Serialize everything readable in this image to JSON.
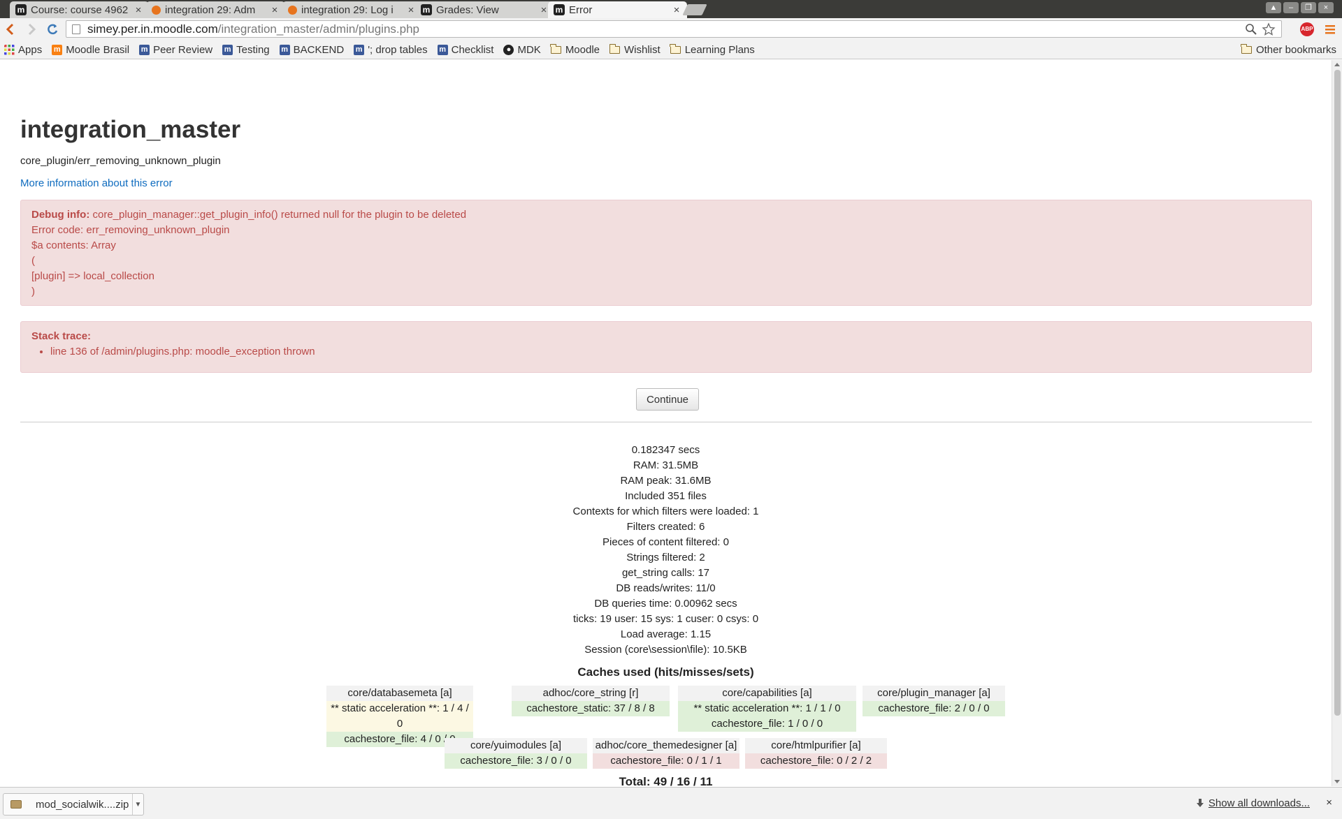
{
  "tabs": [
    {
      "title": "Course: course 4962",
      "favicon": "moodle-icon",
      "active": false
    },
    {
      "title": "integration 29: Adm",
      "favicon": "graduation-hat-icon",
      "active": false
    },
    {
      "title": "integration 29: Log i",
      "favicon": "graduation-hat-icon",
      "active": false
    },
    {
      "title": "Grades: View",
      "favicon": "moodle-icon",
      "active": false
    },
    {
      "title": "Error",
      "favicon": "moodle-icon",
      "active": true
    }
  ],
  "address": {
    "host": "simey.per.in.moodle.com",
    "path": "/integration_master/admin/plugins.php"
  },
  "bookmarks": [
    {
      "label": "Apps",
      "icon": "apps-grid-icon"
    },
    {
      "label": "Moodle Brasil",
      "icon": "moodle-icon"
    },
    {
      "label": "Peer Review",
      "icon": "moodle-icon"
    },
    {
      "label": "Testing",
      "icon": "moodle-icon"
    },
    {
      "label": "BACKEND",
      "icon": "moodle-icon"
    },
    {
      "label": "'; drop tables",
      "icon": "moodle-icon"
    },
    {
      "label": "Checklist",
      "icon": "moodle-icon"
    },
    {
      "label": "MDK",
      "icon": "github-icon"
    },
    {
      "label": "Moodle",
      "icon": "folder-icon"
    },
    {
      "label": "Wishlist",
      "icon": "folder-icon"
    },
    {
      "label": "Learning Plans",
      "icon": "folder-icon"
    }
  ],
  "other_bookmarks": "Other bookmarks",
  "page": {
    "title": "integration_master",
    "error_code_line": "core_plugin/err_removing_unknown_plugin",
    "more_info_link": "More information about this error",
    "debug": {
      "label": "Debug info:",
      "message": "core_plugin_manager::get_plugin_info() returned null for the plugin to be deleted",
      "lines": [
        "Error code: err_removing_unknown_plugin",
        "$a contents: Array",
        "(",
        "[plugin] => local_collection",
        ")"
      ]
    },
    "stack": {
      "label": "Stack trace:",
      "items": [
        "line 136 of /admin/plugins.php: moodle_exception thrown"
      ]
    },
    "continue_label": "Continue",
    "perf": [
      "0.182347 secs",
      "RAM: 31.5MB",
      "RAM peak: 31.6MB",
      "Included 351 files",
      "Contexts for which filters were loaded: 1",
      "Filters created: 6",
      "Pieces of content filtered: 0",
      "Strings filtered: 2",
      "get_string calls: 17",
      "DB reads/writes: 11/0",
      "DB queries time: 0.00962 secs",
      "ticks: 19 user: 15 sys: 1 cuser: 0 csys: 0",
      "Load average: 1.15",
      "Session (core\\session\\file): 10.5KB"
    ],
    "caches_title": "Caches used (hits/misses/sets)",
    "caches": [
      {
        "name": "core/databasemeta [a]",
        "rows": [
          {
            "text": "** static acceleration **: 1 / 4 / 0",
            "status": "yellow"
          },
          {
            "text": "cachestore_file: 4 / 0 / 0",
            "status": "green"
          }
        ]
      },
      {
        "name": "adhoc/core_string [r]",
        "rows": [
          {
            "text": "cachestore_static: 37 / 8 / 8",
            "status": "green"
          }
        ]
      },
      {
        "name": "core/capabilities [a]",
        "rows": [
          {
            "text": "** static acceleration **: 1 / 1 / 0",
            "status": "green"
          },
          {
            "text": "cachestore_file: 1 / 0 / 0",
            "status": "green"
          }
        ]
      },
      {
        "name": "core/plugin_manager [a]",
        "rows": [
          {
            "text": "cachestore_file: 2 / 0 / 0",
            "status": "green"
          }
        ]
      },
      {
        "name": "core/yuimodules [a]",
        "rows": [
          {
            "text": "cachestore_file: 3 / 0 / 0",
            "status": "green"
          }
        ]
      },
      {
        "name": "adhoc/core_themedesigner [a]",
        "rows": [
          {
            "text": "cachestore_file: 0 / 1 / 1",
            "status": "red"
          }
        ]
      },
      {
        "name": "core/htmlpurifier [a]",
        "rows": [
          {
            "text": "cachestore_file: 0 / 2 / 2",
            "status": "red"
          }
        ]
      }
    ],
    "total": "Total: 49 / 16 / 11"
  },
  "downloads": {
    "file": "mod_socialwik....zip",
    "show_all": "Show all downloads...",
    "close": "×"
  },
  "colors": {
    "alert_bg": "#f2dede",
    "alert_text": "#b94a48",
    "link": "#0f6cbf",
    "cache_green": "#dff0d8",
    "cache_yellow": "#fcf8e3",
    "cache_red": "#f2dede"
  }
}
